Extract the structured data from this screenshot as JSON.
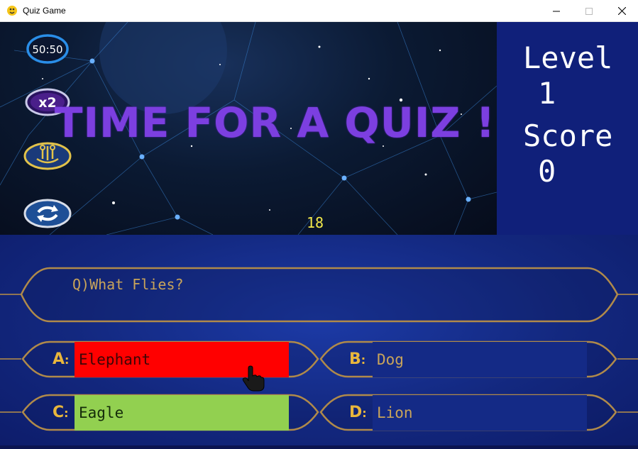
{
  "window": {
    "title": "Quiz Game",
    "controls": {
      "minimize": "minimize-icon",
      "maximize": "maximize-icon",
      "close": "close-icon"
    }
  },
  "banner": {
    "title": "TIME FOR A QUIZ !",
    "timer": "18",
    "title_color": "#7c3fe0",
    "timer_color": "#f2e84a"
  },
  "lifelines": [
    {
      "name": "fifty-fifty",
      "label": "50:50"
    },
    {
      "name": "double-dip",
      "label": "x2"
    },
    {
      "name": "ask-audience",
      "icon": "audience-icon"
    },
    {
      "name": "switch-question",
      "icon": "switch-icon"
    }
  ],
  "side_panel": {
    "level_label": "Level",
    "level_value": "1",
    "score_label": "Score",
    "score_value": "0"
  },
  "question": {
    "text": "Q)What Flies?"
  },
  "answers": [
    {
      "letter": "A",
      "sep": ":",
      "text": "Elephant",
      "state": "wrong",
      "color": "#ff0000"
    },
    {
      "letter": "B",
      "sep": ":",
      "text": "Dog",
      "state": "neutral"
    },
    {
      "letter": "C",
      "sep": ":",
      "text": "Eagle",
      "state": "correct",
      "color": "#92d050"
    },
    {
      "letter": "D",
      "sep": ":",
      "text": "Lion",
      "state": "neutral"
    }
  ]
}
